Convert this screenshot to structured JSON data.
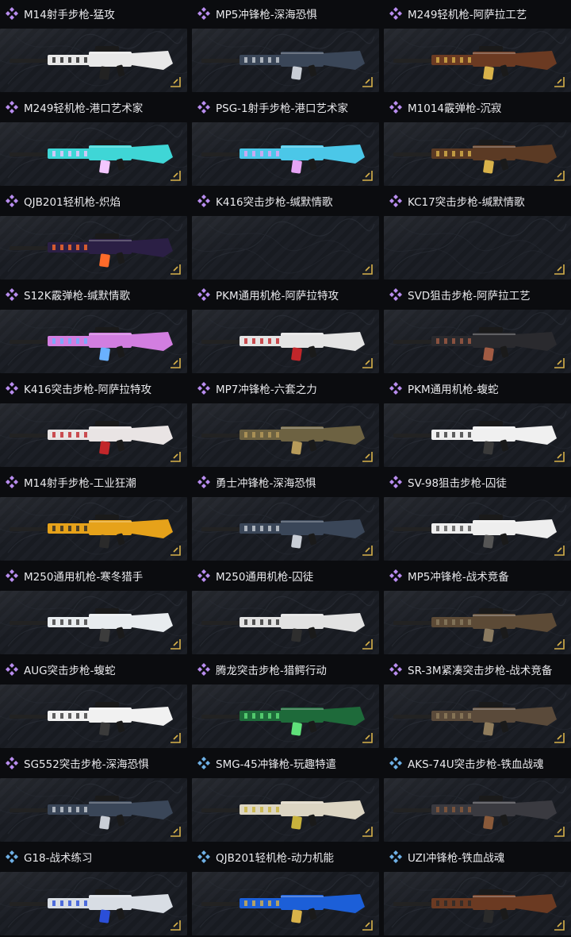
{
  "colors": {
    "purple_rarity": "#b98df0",
    "blue_rarity": "#6fb0e6",
    "background": "#0b0c0f",
    "card_bg": "#1b1e25",
    "gold_corner": "#d8b24a"
  },
  "items": [
    {
      "title": "M14射手步枪-猛攻",
      "rarity": "purple",
      "icon": "diamond-cluster-icon",
      "gun_color": "#e8e8e8",
      "accent": "#222"
    },
    {
      "title": "MP5冲锋枪-深海恐惧",
      "rarity": "purple",
      "icon": "diamond-cluster-icon",
      "gun_color": "#3a4658",
      "accent": "#c9ced6"
    },
    {
      "title": "M249轻机枪-阿萨拉工艺",
      "rarity": "purple",
      "icon": "diamond-cluster-icon",
      "gun_color": "#6b3a22",
      "accent": "#d8b24a"
    },
    {
      "title": "M249轻机枪-港口艺术家",
      "rarity": "purple",
      "icon": "diamond-cluster-icon",
      "gun_color": "#3fd6d6",
      "accent": "#f3c6ff"
    },
    {
      "title": "PSG-1射手步枪-港口艺术家",
      "rarity": "purple",
      "icon": "diamond-cluster-icon",
      "gun_color": "#4bc7e8",
      "accent": "#e6a4f5"
    },
    {
      "title": "M1014霰弹枪-沉寂",
      "rarity": "purple",
      "icon": "diamond-cluster-icon",
      "gun_color": "#5b3a24",
      "accent": "#d8b24a"
    },
    {
      "title": "QJB201轻机枪-炽焰",
      "rarity": "purple",
      "icon": "diamond-cluster-icon",
      "gun_color": "#2b1f45",
      "accent": "#ff6a2a"
    },
    {
      "title": "K416突击步枪-缄默情歌",
      "rarity": "purple",
      "icon": "diamond-cluster-icon",
      "gun_color": "",
      "accent": ""
    },
    {
      "title": "KC17突击步枪-缄默情歌",
      "rarity": "purple",
      "icon": "diamond-cluster-icon",
      "gun_color": "",
      "accent": ""
    },
    {
      "title": "S12K霰弹枪-缄默情歌",
      "rarity": "purple",
      "icon": "diamond-cluster-icon",
      "gun_color": "#d27ee0",
      "accent": "#6ab1ff"
    },
    {
      "title": "PKM通用机枪-阿萨拉特攻",
      "rarity": "purple",
      "icon": "diamond-cluster-icon",
      "gun_color": "#e4e4e4",
      "accent": "#c2262a"
    },
    {
      "title": "SVD狙击步枪-阿萨拉工艺",
      "rarity": "purple",
      "icon": "diamond-cluster-icon",
      "gun_color": "#2a2a2e",
      "accent": "#a15b43"
    },
    {
      "title": "K416突击步枪-阿萨拉特攻",
      "rarity": "purple",
      "icon": "diamond-cluster-icon",
      "gun_color": "#e9e4e4",
      "accent": "#c2262a"
    },
    {
      "title": "MP7冲锋枪-六套之力",
      "rarity": "purple",
      "icon": "diamond-cluster-icon",
      "gun_color": "#6d6242",
      "accent": "#b79b5a"
    },
    {
      "title": "PKM通用机枪-蝮蛇",
      "rarity": "purple",
      "icon": "diamond-cluster-icon",
      "gun_color": "#f0f0f0",
      "accent": "#3a3a3a"
    },
    {
      "title": "M14射手步枪-工业狂潮",
      "rarity": "purple",
      "icon": "diamond-cluster-icon",
      "gun_color": "#e6a21a",
      "accent": "#2a2a2a"
    },
    {
      "title": "勇士冲锋枪-深海恐惧",
      "rarity": "purple",
      "icon": "diamond-cluster-icon",
      "gun_color": "#3a4658",
      "accent": "#c9ced6"
    },
    {
      "title": "SV-98狙击步枪-囚徒",
      "rarity": "purple",
      "icon": "diamond-cluster-icon",
      "gun_color": "#eeeeee",
      "accent": "#555"
    },
    {
      "title": "M250通用机枪-寒冬猎手",
      "rarity": "purple",
      "icon": "diamond-cluster-icon",
      "gun_color": "#e8ecef",
      "accent": "#3b3b3b"
    },
    {
      "title": "M250通用机枪-囚徒",
      "rarity": "purple",
      "icon": "diamond-cluster-icon",
      "gun_color": "#e2e2e2",
      "accent": "#2e2e2e"
    },
    {
      "title": "MP5冲锋枪-战术竞备",
      "rarity": "purple",
      "icon": "diamond-cluster-icon",
      "gun_color": "#5c4a36",
      "accent": "#8a7a60"
    },
    {
      "title": "AUG突击步枪-蝮蛇",
      "rarity": "purple",
      "icon": "diamond-cluster-icon",
      "gun_color": "#f1f1f1",
      "accent": "#3a3a3a"
    },
    {
      "title": "腾龙突击步枪-猎鳄行动",
      "rarity": "purple",
      "icon": "diamond-cluster-icon",
      "gun_color": "#1e6a3a",
      "accent": "#5fe07a"
    },
    {
      "title": "SR-3M紧凑突击步枪-战术竞备",
      "rarity": "purple",
      "icon": "diamond-cluster-icon",
      "gun_color": "#5a4a3a",
      "accent": "#8f7c5c"
    },
    {
      "title": "SG552突击步枪-深海恐惧",
      "rarity": "purple",
      "icon": "diamond-cluster-icon",
      "gun_color": "#3a4658",
      "accent": "#c9ced6"
    },
    {
      "title": "SMG-45冲锋枪-玩趣特遣",
      "rarity": "blue",
      "icon": "diamond-cluster-icon",
      "gun_color": "#dcd5c3",
      "accent": "#c8b23c"
    },
    {
      "title": "AKS-74U突击步枪-铁血战魂",
      "rarity": "blue",
      "icon": "diamond-cluster-icon",
      "gun_color": "#3a3a40",
      "accent": "#8a5a3a"
    },
    {
      "title": "G18-战术练习",
      "rarity": "blue",
      "icon": "diamond-cluster-icon",
      "gun_color": "#d8dde4",
      "accent": "#2b4fd8"
    },
    {
      "title": "QJB201轻机枪-动力机能",
      "rarity": "blue",
      "icon": "diamond-cluster-icon",
      "gun_color": "#1c5fd8",
      "accent": "#d8b24a"
    },
    {
      "title": "UZI冲锋枪-铁血战魂",
      "rarity": "blue",
      "icon": "diamond-cluster-icon",
      "gun_color": "#6b3a22",
      "accent": "#2a2a2a"
    }
  ]
}
